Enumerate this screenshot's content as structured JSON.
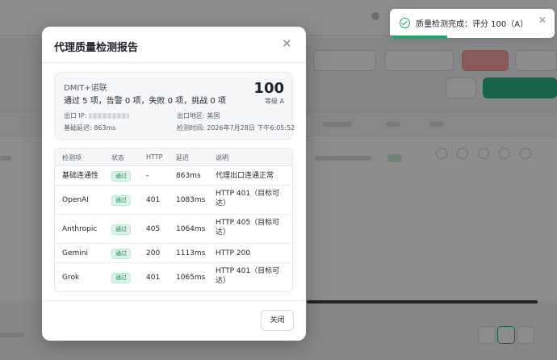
{
  "toast": {
    "icon": "check-circle-icon",
    "message": "质量检测完成：评分 100（A）",
    "close_icon": "close-icon",
    "progress": 0.35,
    "accent": "#22a06b"
  },
  "modal": {
    "title": "代理质量检测报告",
    "close_icon": "close-icon",
    "summary": {
      "proxy_name": "DMIT+诺联",
      "result_text": "通过 5 项，告警 0 项，失败 0 项，挑战 0 项",
      "score": "100",
      "grade": "等级 A",
      "exit_ip_label": "出口 IP:",
      "exit_region": "出口地区: 美国",
      "base_latency": "基础延迟: 863ms",
      "check_time": "检测时间: 2026年7月28日 下午6:05:52"
    },
    "table": {
      "headers": [
        "检测项",
        "状态",
        "HTTP",
        "延迟",
        "说明"
      ],
      "rows": [
        {
          "item": "基础连通性",
          "status": "通过",
          "http": "-",
          "latency": "863ms",
          "note": "代理出口连通正常"
        },
        {
          "item": "OpenAI",
          "status": "通过",
          "http": "401",
          "latency": "1083ms",
          "note": "HTTP 401（目标可达）"
        },
        {
          "item": "Anthropic",
          "status": "通过",
          "http": "405",
          "latency": "1064ms",
          "note": "HTTP 405（目标可达）"
        },
        {
          "item": "Gemini",
          "status": "通过",
          "http": "200",
          "latency": "1113ms",
          "note": "HTTP 200"
        },
        {
          "item": "Grok",
          "status": "通过",
          "http": "401",
          "latency": "1065ms",
          "note": "HTTP 401（目标可达）"
        }
      ]
    },
    "close_button": "关闭"
  },
  "colors": {
    "pass_badge_bg": "#dcf3e7",
    "pass_badge_text": "#1e8a5a",
    "primary_green": "#27b481",
    "danger": "#f7a7a0"
  }
}
